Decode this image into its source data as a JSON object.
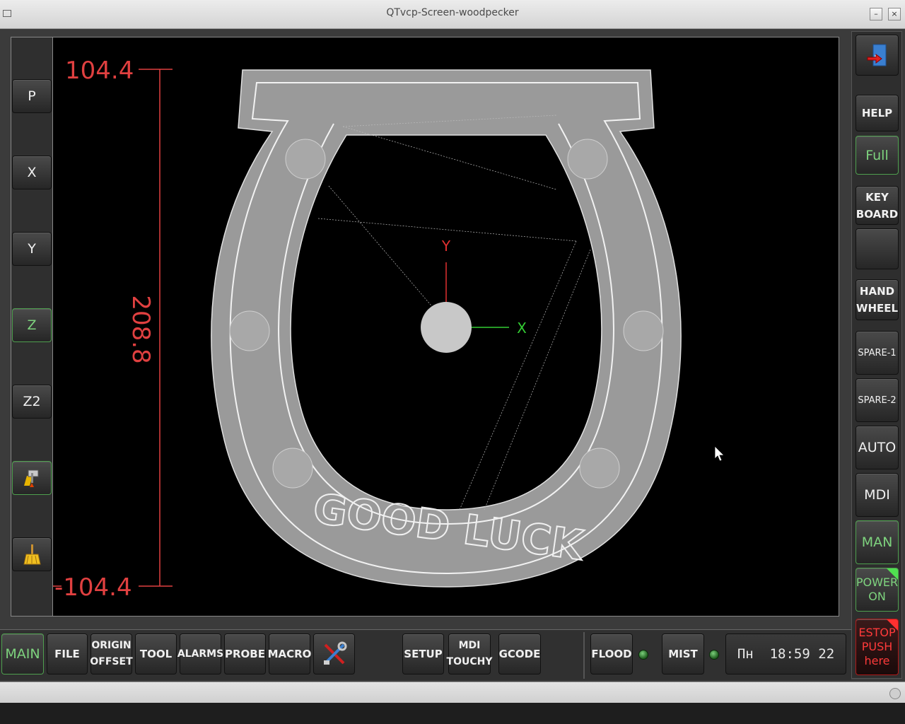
{
  "window": {
    "title": "QTvcp-Screen-woodpecker"
  },
  "left_panel": {
    "buttons": [
      {
        "label": "P"
      },
      {
        "label": "X"
      },
      {
        "label": "Y"
      },
      {
        "label": "Z",
        "active": true
      },
      {
        "label": "Z2"
      }
    ],
    "icons": [
      "touch-off-icon",
      "clear-broom-icon"
    ]
  },
  "viewport": {
    "dimension_top": "104.4",
    "dimension_bottom": "-104.4",
    "dimension_span": "208.8",
    "axis_y_label": "Y",
    "axis_x_label": "X",
    "engraving_text": "GOOD LUCK",
    "colors": {
      "dimension": "#e04040",
      "x_axis": "#33cc33",
      "y_axis": "#e03030",
      "toolpath": "#d8d8d8"
    }
  },
  "right_panel": {
    "exit_icon": "exit-door-icon",
    "help": "HELP",
    "full": "Full",
    "keyboard": [
      "KEY",
      "BOARD"
    ],
    "handwheel": [
      "HAND",
      "WHEEL"
    ],
    "spare1": "SPARE-1",
    "spare2": "SPARE-2",
    "auto": "AUTO",
    "mdi": "MDI",
    "man": "MAN",
    "power": [
      "POWER",
      "ON"
    ],
    "estop": [
      "ESTOP",
      "PUSH",
      "here"
    ]
  },
  "bottom_bar": {
    "tabs": [
      {
        "label": "MAIN",
        "active": true
      },
      {
        "label": "FILE"
      },
      {
        "lines": [
          "ORIGIN",
          "OFFSET"
        ]
      },
      {
        "label": "TOOL"
      },
      {
        "label": "ALARMS"
      },
      {
        "label": "PROBE"
      },
      {
        "label": "MACRO"
      },
      {
        "icon": "tools-icon"
      },
      {
        "label": "SETUP"
      },
      {
        "lines": [
          "MDI",
          "TOUCHY"
        ]
      },
      {
        "label": "GCODE"
      }
    ],
    "flood": "FLOOD",
    "mist": "MIST",
    "clock": "Пн  18:59 22"
  }
}
